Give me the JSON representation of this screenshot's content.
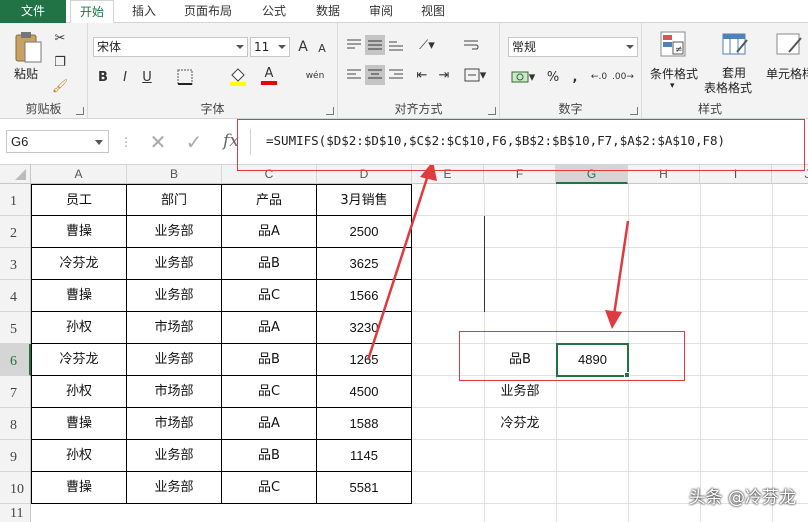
{
  "tabs": [
    "文件",
    "开始",
    "插入",
    "页面布局",
    "公式",
    "数据",
    "审阅",
    "视图"
  ],
  "ribbon": {
    "clipboard": {
      "paste_label": "粘贴",
      "group_label": "剪贴板"
    },
    "font": {
      "font_name": "宋体",
      "font_size": "11",
      "group_label": "字体",
      "bold": "B",
      "italic": "I",
      "underline": "U",
      "phonetic": "wén",
      "font_color_glyph": "A",
      "grow": "A",
      "shrink": "A"
    },
    "alignment": {
      "group_label": "对齐方式"
    },
    "number": {
      "format": "常规",
      "group_label": "数字",
      "percent": "%",
      "comma": ","
    },
    "styles": {
      "conditional_format": "条件格式",
      "table_format_1": "套用",
      "table_format_2": "表格格式",
      "cell_styles": "单元格样",
      "group_label": "样式"
    },
    "accent_color": "#217346"
  },
  "formula_bar": {
    "name_box": "G6",
    "fx": "fx",
    "formula": "=SUMIFS($D$2:$D$10,$C$2:$C$10,F6,$B$2:$B$10,F7,$A$2:$A$10,F8)"
  },
  "sheet": {
    "columns": [
      "A",
      "B",
      "C",
      "D",
      "E",
      "F",
      "G",
      "H",
      "I",
      "J"
    ],
    "rows": [
      "1",
      "2",
      "3",
      "4",
      "5",
      "6",
      "7",
      "8",
      "9",
      "10",
      "11"
    ],
    "selected_column": "G",
    "selected_row": "6",
    "table_header": [
      "员工",
      "部门",
      "产品",
      "3月销售"
    ],
    "table_rows": [
      [
        "曹操",
        "业务部",
        "品A",
        "2500"
      ],
      [
        "冷芬龙",
        "业务部",
        "品B",
        "3625"
      ],
      [
        "曹操",
        "业务部",
        "品C",
        "1566"
      ],
      [
        "孙权",
        "市场部",
        "品A",
        "3230"
      ],
      [
        "冷芬龙",
        "业务部",
        "品B",
        "1265"
      ],
      [
        "孙权",
        "市场部",
        "品C",
        "4500"
      ],
      [
        "曹操",
        "市场部",
        "品A",
        "1588"
      ],
      [
        "孙权",
        "业务部",
        "品B",
        "1145"
      ],
      [
        "曹操",
        "业务部",
        "品C",
        "5581"
      ]
    ],
    "criteria": {
      "F6": "品B",
      "F7": "业务部",
      "F8": "冷芬龙"
    },
    "result": {
      "G6": "4890"
    }
  },
  "watermark": "头条 @冷芬龙",
  "annotation_color": "#e0393e"
}
